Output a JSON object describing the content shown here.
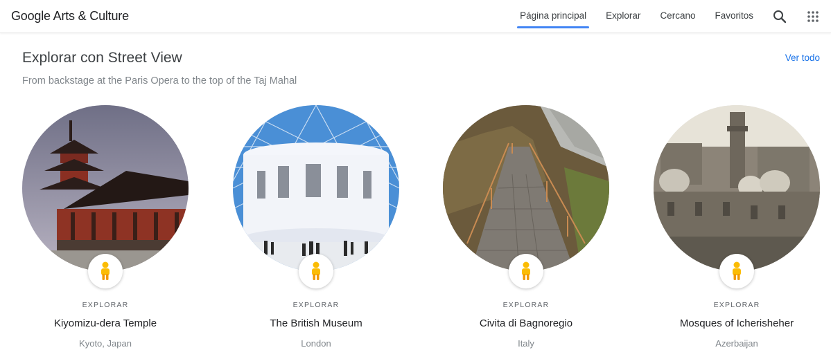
{
  "header": {
    "logo_google": "Google",
    "logo_rest": "Arts & Culture",
    "tabs": [
      {
        "label": "Página principal",
        "active": true
      },
      {
        "label": "Explorar",
        "active": false
      },
      {
        "label": "Cercano",
        "active": false
      },
      {
        "label": "Favoritos",
        "active": false
      }
    ],
    "icons": [
      "search-icon",
      "apps-grid-icon"
    ]
  },
  "section": {
    "title": "Explorar con Street View",
    "subtitle": "From backstage at the Paris Opera to the top of the Taj Mahal",
    "view_all": "Ver todo"
  },
  "cards": [
    {
      "kicker": "EXPLORAR",
      "title": "Kiyomizu-dera Temple",
      "location": "Kyoto, Japan"
    },
    {
      "kicker": "EXPLORAR",
      "title": "The British Museum",
      "location": "London"
    },
    {
      "kicker": "EXPLORAR",
      "title": "Civita di Bagnoregio",
      "location": "Italy"
    },
    {
      "kicker": "EXPLORAR",
      "title": "Mosques of Icherisheher",
      "location": "Azerbaijan"
    }
  ],
  "colors": {
    "accent": "#4285f4",
    "link": "#1a73e8",
    "pegman": "#fbbc04"
  }
}
